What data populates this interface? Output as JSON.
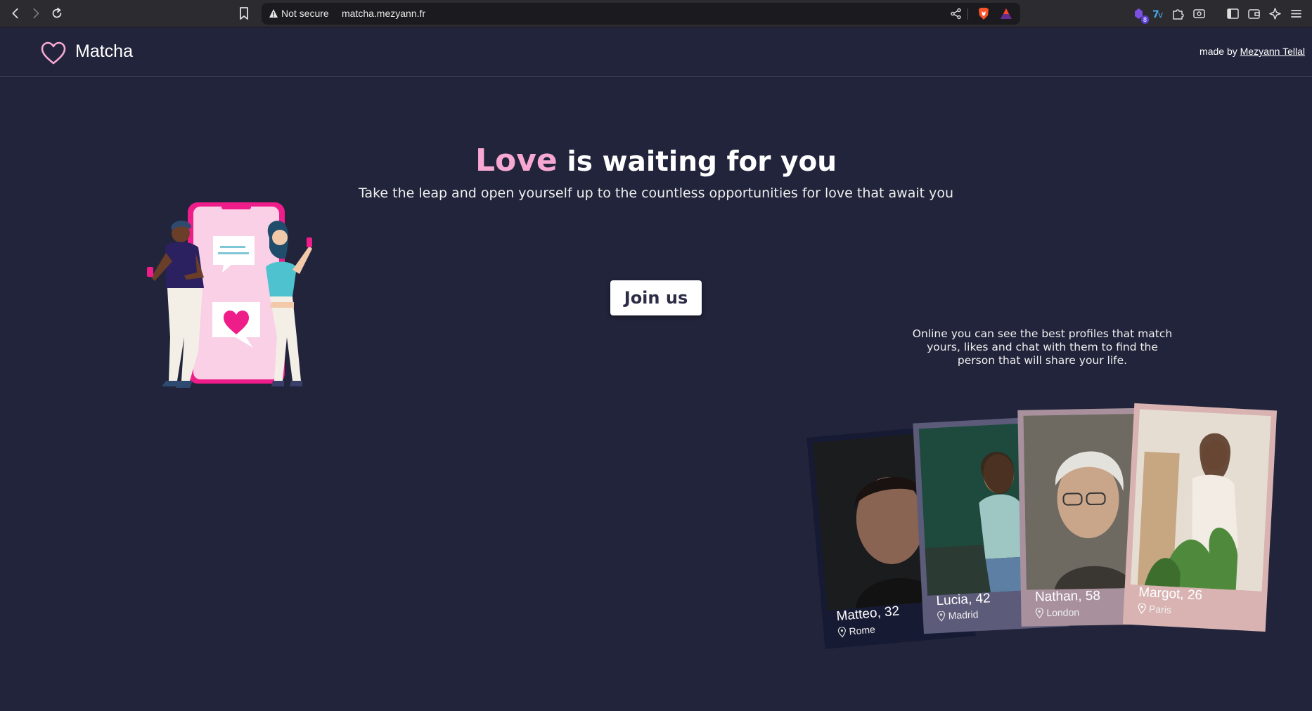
{
  "browser": {
    "security_label": "Not secure",
    "url": "matcha.mezyann.fr",
    "extension_badge": "8"
  },
  "header": {
    "brand": "Matcha",
    "credit_prefix": "made by",
    "credit_author": "Mezyann Tellal"
  },
  "hero": {
    "title_highlight": "Love",
    "title_rest": " is waiting for you",
    "subtitle": "Take the leap and open yourself up to the countless opportunities for love that await you",
    "cta_label": "Join us"
  },
  "side_text": "Online you can see the best profiles that match yours, likes and chat with them to find the person that will share your life.",
  "profiles": [
    {
      "name": "Matteo, 32",
      "city": "Rome"
    },
    {
      "name": "Lucia, 42",
      "city": "Madrid"
    },
    {
      "name": "Nathan, 58",
      "city": "London"
    },
    {
      "name": "Margot, 26",
      "city": "Paris"
    }
  ],
  "colors": {
    "background": "#21243a",
    "accent_pink": "#f6a8d3",
    "heart": "#ee1d8a"
  }
}
